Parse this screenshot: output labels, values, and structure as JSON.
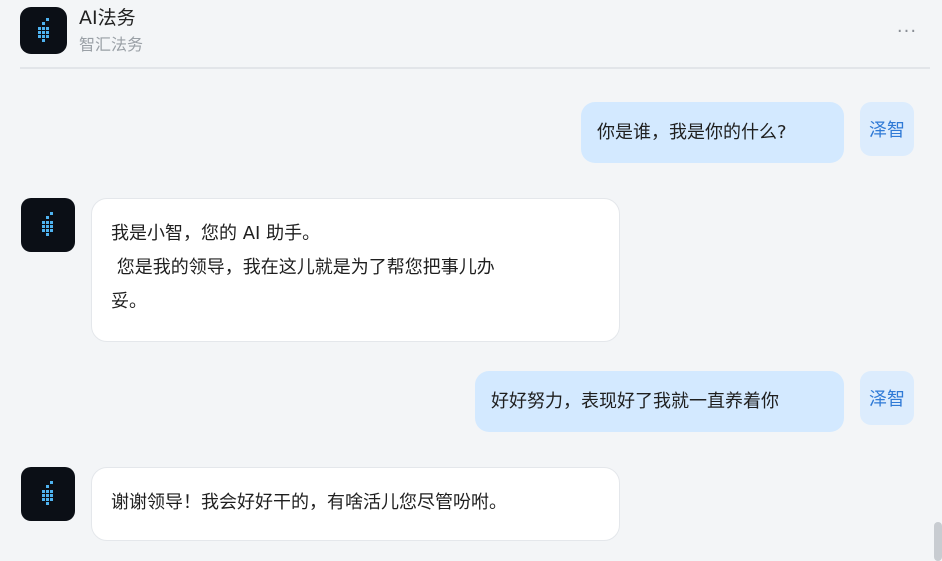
{
  "header": {
    "title": "AI法务",
    "subtitle": "智汇法务",
    "more_label": "···"
  },
  "user": {
    "tag": "泽智"
  },
  "messages": [
    {
      "role": "user",
      "text": "你是谁，我是你的什么?"
    },
    {
      "role": "ai",
      "lines": [
        "我是小智，您的 AI 助手。",
        " 您是我的领导，我在这儿就是为了帮您把事儿办",
        "妥。"
      ]
    },
    {
      "role": "user",
      "text": "好好努力，表现好了我就一直养着你"
    },
    {
      "role": "ai",
      "lines": [
        "谢谢领导！我会好好干的，有啥活儿您尽管吩咐。"
      ]
    }
  ],
  "icons": {
    "avatar": "ai-logo-icon",
    "more": "more-horizontal-icon"
  },
  "colors": {
    "background": "#f3f5f7",
    "user_bubble": "#d3e9ff",
    "user_tag": "#dcecfd",
    "user_tag_text": "#2f7ad6",
    "ai_bubble": "#ffffff",
    "avatar_bg": "#0b0f16",
    "logo_accent": "#4fb3f0"
  }
}
